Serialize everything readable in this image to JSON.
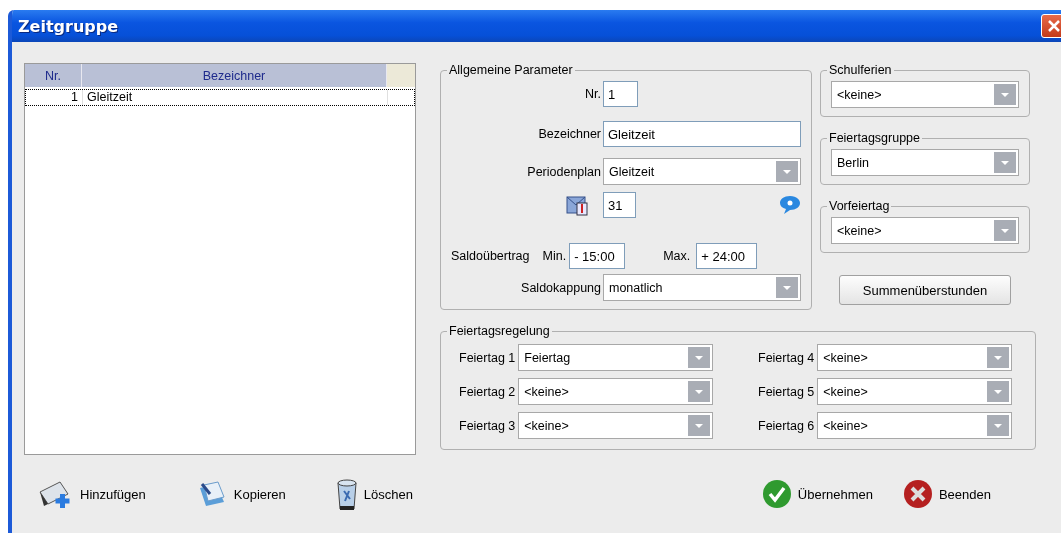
{
  "window": {
    "title": "Zeitgruppe"
  },
  "list": {
    "columns": [
      "Nr.",
      "Bezeichner"
    ],
    "rows": [
      {
        "cells": [
          "1",
          "Gleitzeit"
        ],
        "selected": true
      }
    ]
  },
  "general": {
    "title": "Allgemeine Parameter",
    "fields": [
      {
        "kind": "number",
        "label": "Nr.",
        "value": "1"
      },
      {
        "kind": "text",
        "label": "Bezeichner",
        "value": "Gleitzeit"
      },
      {
        "kind": "select",
        "label": "Periodenplan",
        "value": "Gleitzeit"
      },
      {
        "kind": "counter",
        "value": "31"
      }
    ],
    "carryover": {
      "label": "Saldoübertrag",
      "min_label": "Min.",
      "min": "- 15:00",
      "max_label": "Max.",
      "max": "+ 24:00"
    },
    "capping": {
      "label": "Saldokappung",
      "value": "monatlich"
    }
  },
  "side_groups": [
    {
      "title": "Schulferien",
      "value": "<keine>"
    },
    {
      "title": "Feiertagsgruppe",
      "value": "Berlin"
    },
    {
      "title": "Vorfeiertag",
      "value": "<keine>"
    }
  ],
  "side_button": "Summenüberstunden",
  "holiday_rules": {
    "title": "Feiertagsregelung",
    "items": [
      {
        "label": "Feiertag 1",
        "value": "Feiertag"
      },
      {
        "label": "Feiertag 2",
        "value": "<keine>"
      },
      {
        "label": "Feiertag 3",
        "value": "<keine>"
      },
      {
        "label": "Feiertag 4",
        "value": "<keine>"
      },
      {
        "label": "Feiertag 5",
        "value": "<keine>"
      },
      {
        "label": "Feiertag 6",
        "value": "<keine>"
      }
    ]
  },
  "toolbar": [
    {
      "kind": "add",
      "label": "Hinzufügen"
    },
    {
      "kind": "copy",
      "label": "Kopieren"
    },
    {
      "kind": "delete",
      "label": "Löschen"
    }
  ],
  "actions": [
    {
      "kind": "apply",
      "label": "Übernehmen"
    },
    {
      "kind": "close",
      "label": "Beenden"
    }
  ]
}
